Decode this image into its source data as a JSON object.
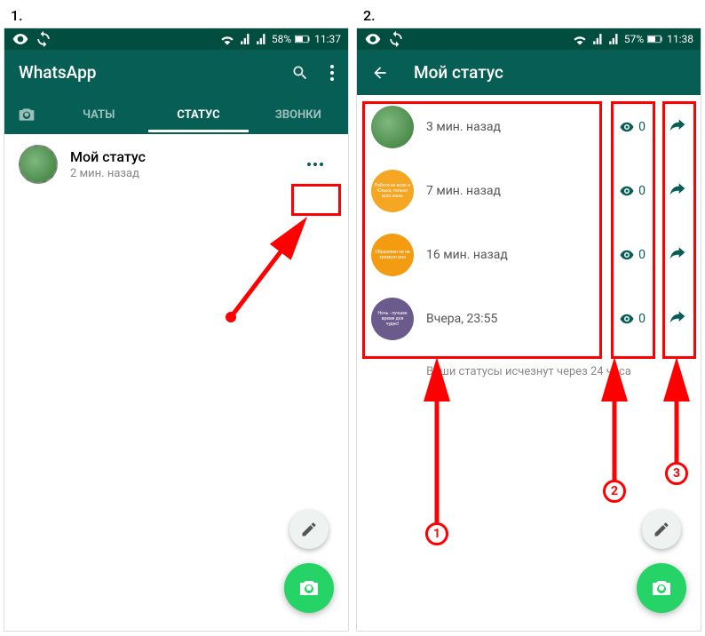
{
  "panel_labels": {
    "left": "1.",
    "right": "2."
  },
  "colors": {
    "primary": "#075E54",
    "accent": "#25D366",
    "highlight": "#ff0000"
  },
  "left": {
    "status_bar": {
      "battery": "58%",
      "time": "11:37"
    },
    "app_title": "WhatsApp",
    "tabs": {
      "chats": "ЧАТЫ",
      "status": "СТАТУС",
      "calls": "ЗВОНКИ"
    },
    "my_status": {
      "title": "Мой статус",
      "time": "2 мин. назад"
    }
  },
  "right": {
    "status_bar": {
      "battery": "57%",
      "time": "11:38"
    },
    "header_title": "Мой статус",
    "items": [
      {
        "time": "3 мин. назад",
        "views": "0",
        "avatar": "green",
        "text": ""
      },
      {
        "time": "7 мин. назад",
        "views": "0",
        "avatar": "orange1",
        "text": "Работа не волк и Юлька, только всех жаль"
      },
      {
        "time": "16 мин. назад",
        "views": "0",
        "avatar": "orange2",
        "text": "Образован не на трезвую ума"
      },
      {
        "time": "Вчера, 23:55",
        "views": "0",
        "avatar": "purple",
        "text": "Ночь - лучшее время для чудес!"
      }
    ],
    "footer": "Ваши статусы исчезнут через 24 часа"
  },
  "badges": {
    "one": "1",
    "two": "2",
    "three": "3"
  }
}
